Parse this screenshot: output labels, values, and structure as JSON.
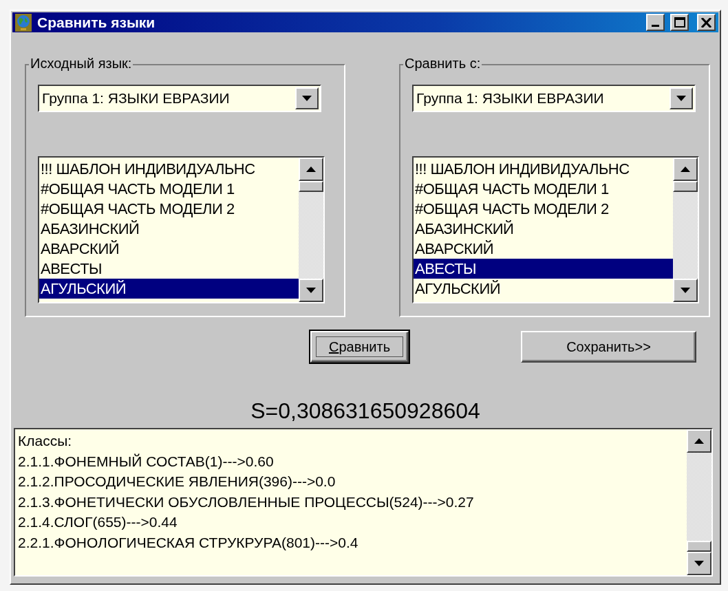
{
  "window": {
    "title": "Сравнить языки"
  },
  "panels": [
    {
      "label": "Исходный язык:",
      "combo": {
        "value": "Группа 1: ЯЗЫКИ ЕВРАЗИИ"
      },
      "items": [
        {
          "text": "!!! ШАБЛОН ИНДИВИДУАЛЬНС",
          "selected": false
        },
        {
          "text": "#ОБЩАЯ ЧАСТЬ МОДЕЛИ 1",
          "selected": false
        },
        {
          "text": "#ОБЩАЯ ЧАСТЬ МОДЕЛИ 2",
          "selected": false
        },
        {
          "text": "АБАЗИНСКИЙ",
          "selected": false
        },
        {
          "text": "АВАРСКИЙ",
          "selected": false
        },
        {
          "text": "АВЕСТЫ",
          "selected": false
        },
        {
          "text": "АГУЛЬСКИЙ",
          "selected": true
        }
      ]
    },
    {
      "label": "Сравнить с:",
      "combo": {
        "value": "Группа 1: ЯЗЫКИ ЕВРАЗИИ"
      },
      "items": [
        {
          "text": "!!! ШАБЛОН ИНДИВИДУАЛЬНС",
          "selected": false
        },
        {
          "text": "#ОБЩАЯ ЧАСТЬ МОДЕЛИ 1",
          "selected": false
        },
        {
          "text": "#ОБЩАЯ ЧАСТЬ МОДЕЛИ 2",
          "selected": false
        },
        {
          "text": "АБАЗИНСКИЙ",
          "selected": false
        },
        {
          "text": "АВАРСКИЙ",
          "selected": false
        },
        {
          "text": "АВЕСТЫ",
          "selected": true
        },
        {
          "text": "АГУЛЬСКИЙ",
          "selected": false
        }
      ]
    }
  ],
  "buttons": [
    {
      "label": "Сравнить",
      "default": true,
      "mnemonic": true
    },
    {
      "label": "Сохранить>>",
      "default": false,
      "mnemonic": false
    }
  ],
  "result": "S=0,308631650928604",
  "output_lines": [
    "Классы:",
    "2.1.1.ФОНЕМНЫЙ СОСТАВ(1)--->0.60",
    "2.1.2.ПРОСОДИЧЕСКИЕ ЯВЛЕНИЯ(396)--->0.0",
    "2.1.3.ФОНЕТИЧЕСКИ ОБУСЛОВЛЕННЫЕ ПРОЦЕССЫ(524)--->0.27",
    "2.1.4.СЛОГ(655)--->0.44",
    "2.2.1.ФОНОЛОГИЧЕСКАЯ СТРУКРУРА(801)--->0.4"
  ]
}
